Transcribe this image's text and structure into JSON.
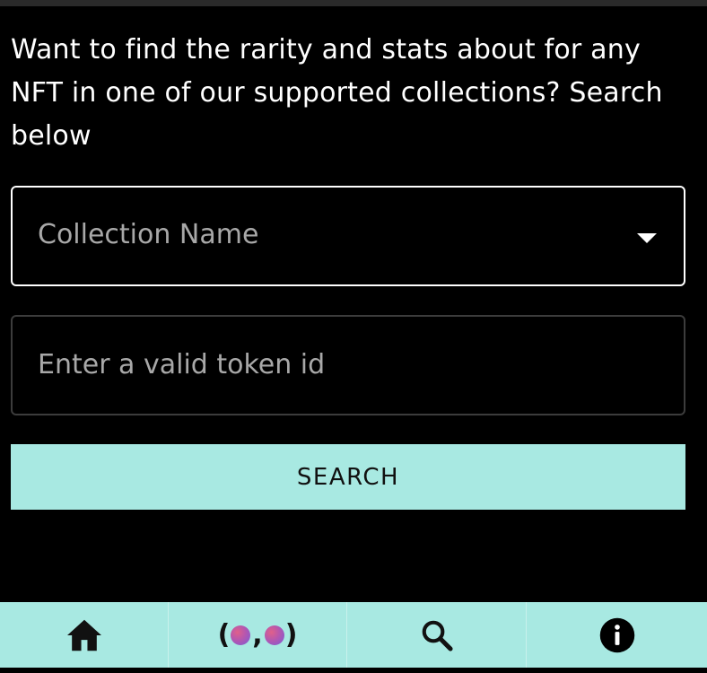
{
  "intro_text": "Want to find the rarity and stats about for any NFT in one of our supported collections? Search below",
  "collection_select": {
    "placeholder": "Collection Name"
  },
  "token_input": {
    "placeholder": "Enter a valid token id",
    "value": ""
  },
  "search_button": {
    "label": "SEARCH"
  },
  "bottom_nav": {
    "items": [
      {
        "icon": "home-icon"
      },
      {
        "icon": "eyes-logo-icon",
        "left_paren": "(",
        "comma": ",",
        "right_paren": ")"
      },
      {
        "icon": "search-icon"
      },
      {
        "icon": "info-icon"
      }
    ]
  },
  "colors": {
    "background": "#000000",
    "accent": "#a8e9e2",
    "placeholder": "#a8a8a8",
    "text": "#ffffff"
  }
}
